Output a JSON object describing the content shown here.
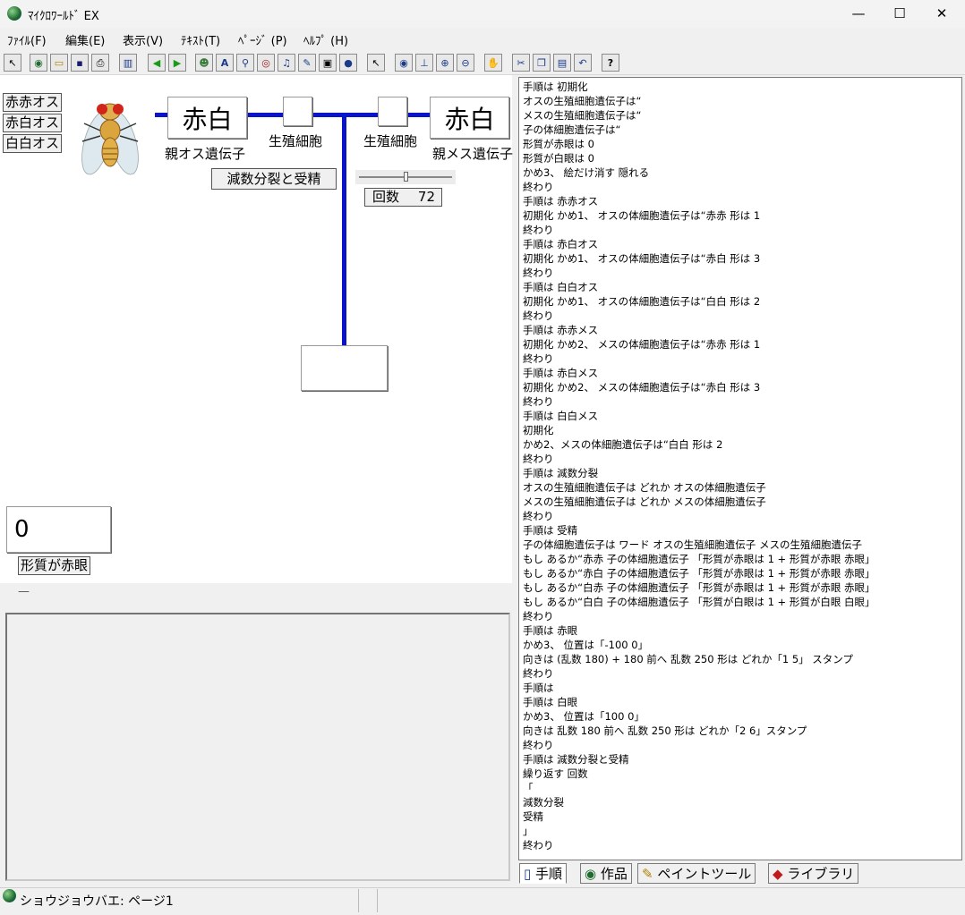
{
  "window": {
    "title": "ﾏｲｸﾛﾜｰﾙﾄﾞ EX",
    "minimize": "—",
    "maximize": "☐",
    "close": "✕"
  },
  "menu": [
    "ﾌｧｲﾙ(F)",
    "編集(E)",
    "表示(V)",
    "ﾃｷｽﾄ(T)",
    "ﾍﾟｰｼﾞ (P)",
    "ﾍﾙﾌﾟ (H)"
  ],
  "toolbar": [
    {
      "icon": "cursor-icon",
      "glyph": "↖"
    },
    {
      "icon": "globe-icon",
      "glyph": "◉"
    },
    {
      "icon": "open-folder-icon",
      "glyph": "▭"
    },
    {
      "icon": "save-icon",
      "glyph": "▪"
    },
    {
      "icon": "print-icon",
      "glyph": "⎙"
    },
    {
      "icon": "layout-icon",
      "glyph": "▥"
    },
    {
      "icon": "back-arrow-icon",
      "glyph": "◀"
    },
    {
      "icon": "forward-arrow-icon",
      "glyph": "▶"
    },
    {
      "icon": "character-icon",
      "glyph": "☻"
    },
    {
      "icon": "text-tool-icon",
      "glyph": "A"
    },
    {
      "icon": "antenna-icon",
      "glyph": "⚲"
    },
    {
      "icon": "eye-icon",
      "glyph": "◎"
    },
    {
      "icon": "music-icon",
      "glyph": "♫"
    },
    {
      "icon": "pencil-icon",
      "glyph": "✎"
    },
    {
      "icon": "camera-icon",
      "glyph": "▣"
    },
    {
      "icon": "helmet-icon",
      "glyph": "●"
    },
    {
      "icon": "pointer-icon",
      "glyph": "↖"
    },
    {
      "icon": "view-icon",
      "glyph": "◉"
    },
    {
      "icon": "stamp-icon",
      "glyph": "⊥"
    },
    {
      "icon": "zoom-in-icon",
      "glyph": "⊕"
    },
    {
      "icon": "zoom-out-icon",
      "glyph": "⊖"
    },
    {
      "icon": "stop-icon",
      "glyph": "✋"
    },
    {
      "icon": "cut-icon",
      "glyph": "✂"
    },
    {
      "icon": "copy-icon",
      "glyph": "❐"
    },
    {
      "icon": "paste-icon",
      "glyph": "▤"
    },
    {
      "icon": "undo-icon",
      "glyph": "↶"
    },
    {
      "icon": "help-icon",
      "glyph": "?"
    }
  ],
  "stage": {
    "buttons": [
      "赤赤オス",
      "赤白オス",
      "白白オス"
    ],
    "parent_male_box": "赤白",
    "parent_male_label": "親オス遺伝子",
    "germ_cell_left_label": "生殖細胞",
    "germ_cell_right_label": "生殖細胞",
    "parent_female_box": "赤白",
    "parent_female_label": "親メス遺伝子",
    "meiosis_button": "減数分裂と受精",
    "slider_level": 0.5,
    "count_label": "回数",
    "count_value": "72",
    "counter_value": "0",
    "trait_button": "形質が赤眼",
    "separator_mark": "—"
  },
  "script_lines": [
    "手順は 初期化",
    "オスの生殖細胞遺伝子は“",
    "メスの生殖細胞遺伝子は“",
    "子の体細胞遺伝子は“",
    "形質が赤眼は 0",
    "形質が白眼は 0",
    "かめ3、 絵だけ消す 隠れる",
    "終わり",
    "手順は 赤赤オス",
    "初期化 かめ1、 オスの体細胞遺伝子は“赤赤 形は 1",
    "終わり",
    "手順は 赤白オス",
    "初期化 かめ1、 オスの体細胞遺伝子は“赤白 形は 3",
    "終わり",
    "手順は 白白オス",
    "初期化 かめ1、 オスの体細胞遺伝子は“白白 形は 2",
    "終わり",
    "手順は 赤赤メス",
    "初期化 かめ2、 メスの体細胞遺伝子は“赤赤 形は 1",
    "終わり",
    "手順は 赤白メス",
    "初期化 かめ2、 メスの体細胞遺伝子は“赤白 形は 3",
    "終わり",
    "手順は 白白メス",
    "初期化",
    "かめ2、メスの体細胞遺伝子は“白白 形は 2",
    "終わり",
    "手順は 減数分裂",
    "オスの生殖細胞遺伝子は どれか オスの体細胞遺伝子",
    "メスの生殖細胞遺伝子は どれか メスの体細胞遺伝子",
    "終わり",
    "手順は 受精",
    "子の体細胞遺伝子は ワード オスの生殖細胞遺伝子 メスの生殖細胞遺伝子",
    "もし あるか“赤赤 子の体細胞遺伝子 「形質が赤眼は 1 + 形質が赤眼 赤眼」",
    "もし あるか“赤白 子の体細胞遺伝子 「形質が赤眼は 1 + 形質が赤眼 赤眼」",
    "もし あるか“白赤 子の体細胞遺伝子 「形質が赤眼は 1 + 形質が赤眼 赤眼」",
    "もし あるか“白白 子の体細胞遺伝子 「形質が白眼は 1 + 形質が白眼 白眼」",
    "終わり",
    "手順は 赤眼",
    "かめ3、 位置は「-100 0」",
    "向きは (乱数 180) + 180 前へ 乱数 250 形は どれか「1 5」 スタンプ",
    "終わり",
    "手順は",
    "手順は 白眼",
    "かめ3、 位置は「100 0」",
    "向きは 乱数 180 前へ 乱数 250 形は どれか「2 6」スタンプ",
    "終わり",
    "手順は 減数分裂と受精",
    "繰り返す 回数",
    "「",
    "減数分裂",
    "受精",
    "」",
    "終わり"
  ],
  "tabs": [
    {
      "icon": "book-icon",
      "glyph": "▯",
      "label": "手順"
    },
    {
      "icon": "globe-icon",
      "glyph": "◉",
      "label": "作品"
    },
    {
      "icon": "brush-icon",
      "glyph": "✎",
      "label": "ペイントツール"
    },
    {
      "icon": "library-icon",
      "glyph": "◆",
      "label": "ライブラリ"
    }
  ],
  "status": {
    "text": "ショウジョウバエ: ページ1"
  }
}
